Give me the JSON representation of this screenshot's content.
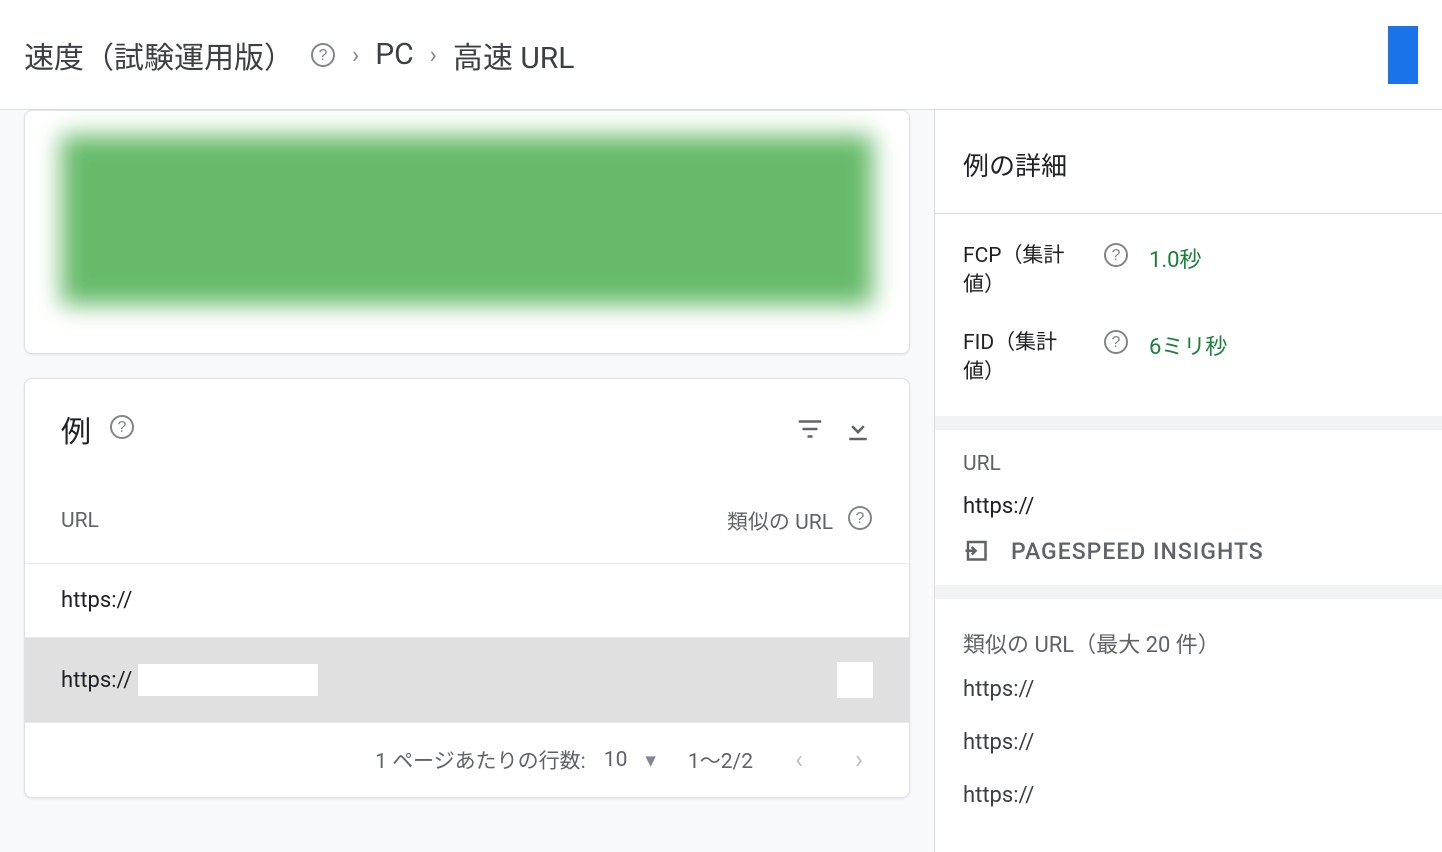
{
  "header": {
    "crumb1": "速度（試験運用版）",
    "crumb2": "PC",
    "crumb3": "高速 URL"
  },
  "examples": {
    "title": "例",
    "col_url": "URL",
    "col_similar": "類似の URL",
    "rows": [
      {
        "url": "https://",
        "selected": false
      },
      {
        "url": "https://",
        "selected": true
      }
    ],
    "pager": {
      "rows_per_page_label": "1 ページあたりの行数:",
      "rows_per_page_value": "10",
      "range": "1～2/2"
    }
  },
  "side": {
    "title": "例の詳細",
    "metrics": [
      {
        "label": "FCP（集計値）",
        "value": "1.0秒"
      },
      {
        "label": "FID（集計値）",
        "value": "6ミリ秒"
      }
    ],
    "url_label": "URL",
    "url_value": "https://",
    "psi_label": "PAGESPEED INSIGHTS",
    "similar_label": "類似の URL（最大 20 件）",
    "similar_urls": [
      "https://",
      "https://",
      "https://"
    ]
  }
}
